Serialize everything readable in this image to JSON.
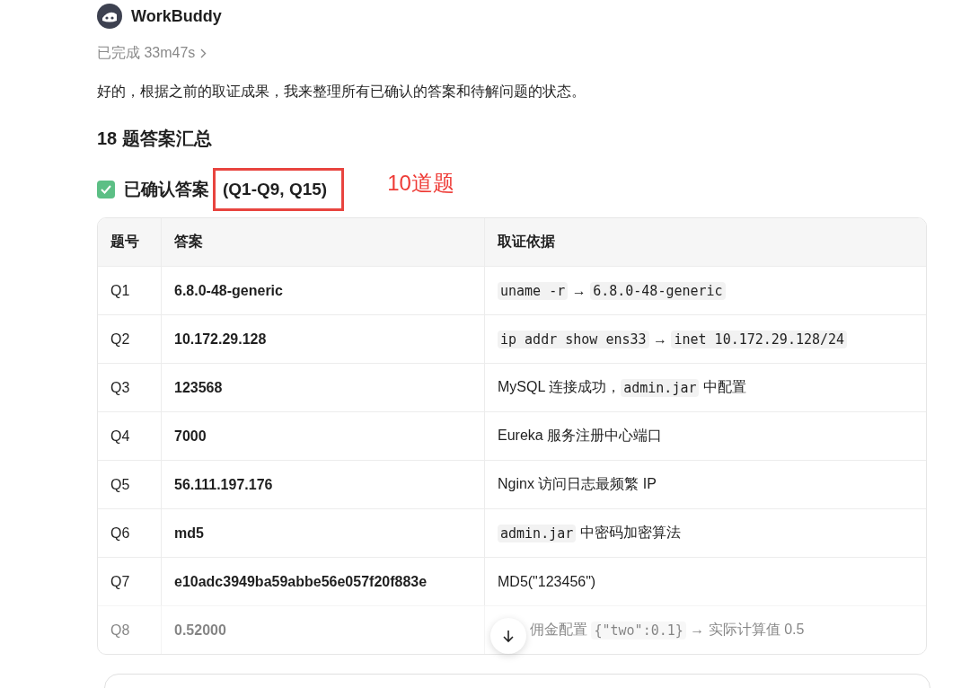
{
  "header": {
    "name": "WorkBuddy"
  },
  "status": {
    "text": "已完成 33m47s"
  },
  "intro": "好的，根据之前的取证成果，我来整理所有已确认的答案和待解问题的状态。",
  "heading": "18 题答案汇总",
  "section": {
    "checked": true,
    "title": "已确认答案",
    "range": "(Q1-Q9, Q15)",
    "note": "10道题"
  },
  "table": {
    "columns": [
      "题号",
      "答案",
      "取证依据"
    ],
    "rows": [
      {
        "id": "Q1",
        "answer": "6.8.0-48-generic",
        "faded": false,
        "evidence": [
          {
            "kind": "code",
            "text": "uname -r"
          },
          {
            "kind": "text",
            "text": " → "
          },
          {
            "kind": "code",
            "text": "6.8.0-48-generic"
          }
        ]
      },
      {
        "id": "Q2",
        "answer": "10.172.29.128",
        "faded": false,
        "evidence": [
          {
            "kind": "code",
            "text": "ip addr show ens33"
          },
          {
            "kind": "text",
            "text": " → "
          },
          {
            "kind": "code",
            "text": "inet 10.172.29.128/24"
          }
        ]
      },
      {
        "id": "Q3",
        "answer": "123568",
        "faded": false,
        "evidence": [
          {
            "kind": "text",
            "text": "MySQL 连接成功，"
          },
          {
            "kind": "code",
            "text": "admin.jar"
          },
          {
            "kind": "text",
            "text": " 中配置"
          }
        ]
      },
      {
        "id": "Q4",
        "answer": "7000",
        "faded": false,
        "evidence": [
          {
            "kind": "text",
            "text": "Eureka 服务注册中心端口"
          }
        ]
      },
      {
        "id": "Q5",
        "answer": "56.111.197.176",
        "faded": false,
        "evidence": [
          {
            "kind": "text",
            "text": "Nginx 访问日志最频繁 IP"
          }
        ]
      },
      {
        "id": "Q6",
        "answer": "md5",
        "faded": false,
        "evidence": [
          {
            "kind": "code",
            "text": "admin.jar"
          },
          {
            "kind": "text",
            "text": " 中密码加密算法"
          }
        ]
      },
      {
        "id": "Q7",
        "answer": "e10adc3949ba59abbe56e057f20f883e",
        "faded": false,
        "evidence": [
          {
            "kind": "text",
            "text": "MD5(\"123456\")"
          }
        ]
      },
      {
        "id": "Q8",
        "answer": "0.52000",
        "faded": true,
        "evidence": [
          {
            "kind": "text",
            "text": "佣金配置 "
          },
          {
            "kind": "code",
            "text": "{\"two\":0.1}"
          },
          {
            "kind": "text",
            "text": " → 实际计算值 0.5"
          }
        ]
      }
    ]
  }
}
